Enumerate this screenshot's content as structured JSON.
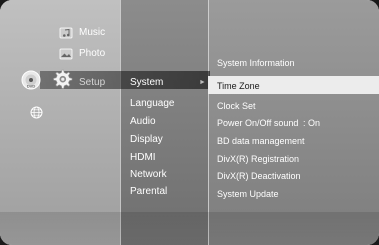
{
  "main_menu": {
    "items": [
      {
        "label": "Music",
        "icon": "music-note-icon"
      },
      {
        "label": "Photo",
        "icon": "photo-icon"
      },
      {
        "label": "Setup",
        "icon": "gear-icon"
      }
    ]
  },
  "sub_menu": {
    "items": [
      "System",
      "Language",
      "Audio",
      "Display",
      "HDMI",
      "Network",
      "Parental"
    ],
    "selected": "System"
  },
  "options_menu": {
    "items": [
      {
        "label": "System Information"
      },
      {
        "label": "Time Zone"
      },
      {
        "label": "Clock Set"
      },
      {
        "label": "Power On/Off sound",
        "value": ": On"
      },
      {
        "label": "BD data management"
      },
      {
        "label": "DivX(R) Registration"
      },
      {
        "label": "DivX(R) Deactivation"
      },
      {
        "label": "System Update"
      }
    ],
    "selected": "Time Zone"
  },
  "colors": {
    "highlight": "#ececec",
    "text": "#ffffff"
  },
  "icons": [
    "disc-dvd-icon",
    "gear-icon",
    "globe-icon",
    "arrow-right-icon"
  ]
}
